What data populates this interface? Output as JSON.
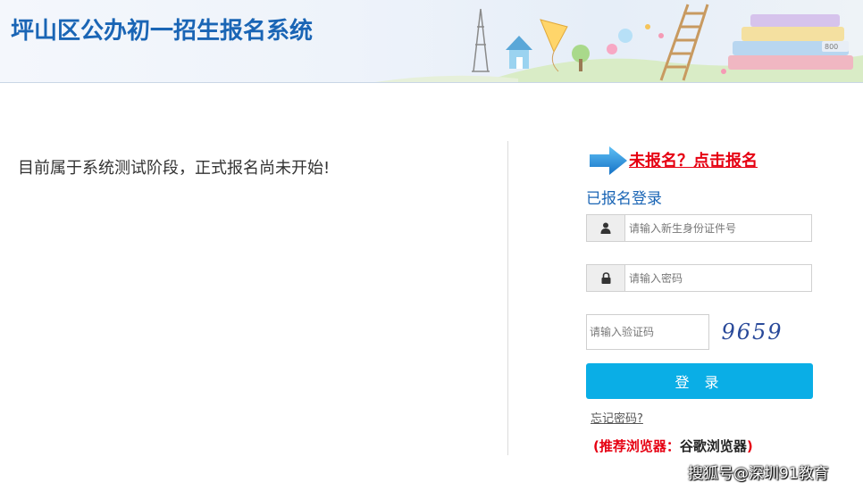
{
  "header": {
    "title": "坪山区公办初一招生报名系统",
    "badge_text": "800"
  },
  "notice": "目前属于系统测试阶段，正式报名尚未开始!",
  "register": {
    "link_label": "未报名？点击报名",
    "arrow_icon": "arrow-right-icon"
  },
  "login": {
    "title": "已报名登录",
    "id_field": {
      "placeholder": "请输入新生身份证件号",
      "value": "",
      "icon": "user-icon"
    },
    "password_field": {
      "placeholder": "请输入密码",
      "value": "",
      "icon": "lock-icon"
    },
    "captcha_field": {
      "placeholder": "请输入验证码",
      "value": ""
    },
    "captcha_code": "9659",
    "submit_label": "登 录",
    "forgot_label": "忘记密码?",
    "browser_tip_prefix": "(推荐浏览器：",
    "browser_tip_name": "谷歌浏览器",
    "browser_tip_suffix": ")"
  },
  "watermark": "搜狐号@深圳91教育",
  "colors": {
    "brand_blue": "#1a65b5",
    "accent_red": "#e60012",
    "button_blue": "#0aaee6"
  }
}
